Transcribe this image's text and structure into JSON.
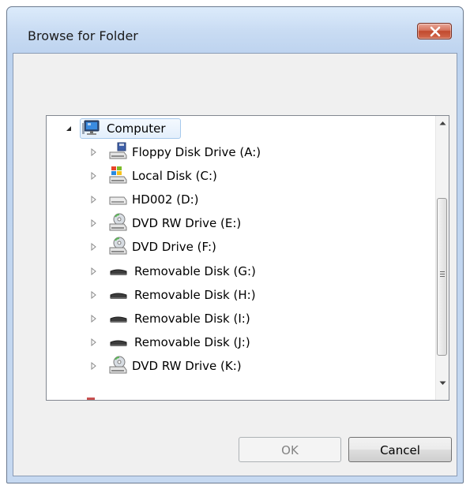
{
  "window": {
    "title": "Browse for Folder"
  },
  "tree": {
    "root": {
      "label": "Computer",
      "icon": "computer-icon",
      "expanded": true
    },
    "items": [
      {
        "label": "Floppy Disk Drive (A:)",
        "icon": "floppy-drive-icon"
      },
      {
        "label": "Local Disk (C:)",
        "icon": "windows-drive-icon"
      },
      {
        "label": "HD002 (D:)",
        "icon": "hard-drive-icon"
      },
      {
        "label": "DVD RW Drive (E:)",
        "icon": "dvd-drive-icon"
      },
      {
        "label": "DVD Drive (F:)",
        "icon": "dvd-drive-icon"
      },
      {
        "label": "Removable Disk (G:)",
        "icon": "removable-disk-icon"
      },
      {
        "label": "Removable Disk (H:)",
        "icon": "removable-disk-icon"
      },
      {
        "label": "Removable Disk (I:)",
        "icon": "removable-disk-icon"
      },
      {
        "label": "Removable Disk (J:)",
        "icon": "removable-disk-icon"
      },
      {
        "label": "DVD RW Drive (K:)",
        "icon": "dvd-drive-icon"
      }
    ]
  },
  "buttons": {
    "ok_label": "OK",
    "cancel_label": "Cancel"
  },
  "colors": {
    "selection_border": "#a6c9ec",
    "close_button": "#c14a2e"
  }
}
